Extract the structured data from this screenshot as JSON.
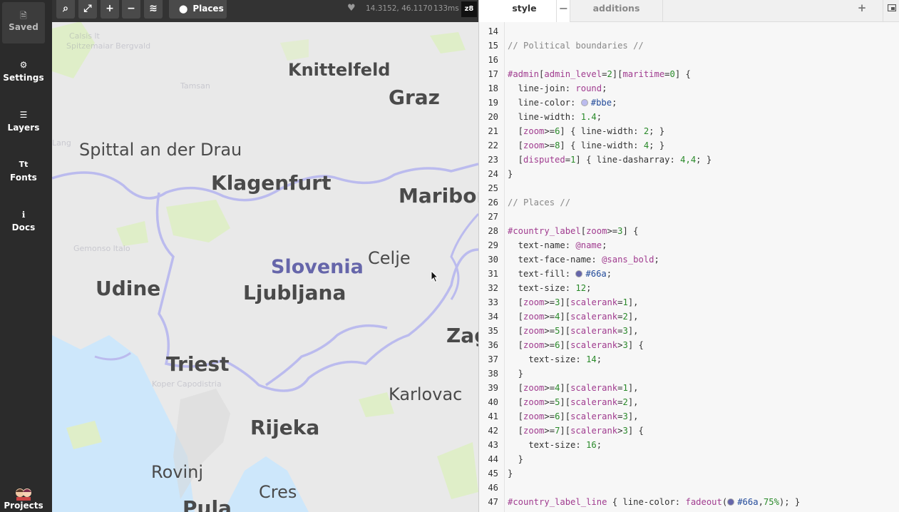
{
  "sidebar": {
    "items": [
      {
        "label": "Saved",
        "icon": "document-icon",
        "glyph": "🗎"
      },
      {
        "label": "Settings",
        "icon": "gear-icon",
        "glyph": "⚙"
      },
      {
        "label": "Layers",
        "icon": "layers-icon",
        "glyph": "☰"
      },
      {
        "label": "Fonts",
        "icon": "fonts-icon",
        "glyph": "Tt"
      },
      {
        "label": "Docs",
        "icon": "info-icon",
        "glyph": "ℹ"
      }
    ],
    "projects_label": "Projects"
  },
  "map_toolbar": {
    "buttons": [
      {
        "name": "search-button",
        "icon": "search-icon",
        "glyph": "⌕"
      },
      {
        "name": "fullscreen-button",
        "icon": "expand-icon",
        "glyph": "⤢"
      },
      {
        "name": "zoom-in-button",
        "icon": "plus-icon",
        "glyph": "+"
      },
      {
        "name": "zoom-out-button",
        "icon": "minus-icon",
        "glyph": "−"
      },
      {
        "name": "layers-query-button",
        "icon": "layers-search-icon",
        "glyph": "≋"
      }
    ],
    "places_label": "Places",
    "coordinates": "14.3152, 46.1170",
    "render_time": "133ms",
    "zoom_level": "z8"
  },
  "map": {
    "country_label": "Slovenia",
    "cities": [
      "Knittelfeld",
      "Graz",
      "Spittal an der Drau",
      "Klagenfurt",
      "Maribor",
      "Celje",
      "Udine",
      "Ljubljana",
      "Zag",
      "Triest",
      "Karlovac",
      "Rijeka",
      "Rovinj",
      "Cres",
      "Pula"
    ],
    "colors": {
      "land": "#e9e9e9",
      "water": "#cde7fb",
      "park": "#dfeec8",
      "boundary": "#bbe",
      "country_text": "#66a"
    }
  },
  "editor": {
    "tabs": [
      {
        "label": "style",
        "active": true
      },
      {
        "label": "additions",
        "active": false
      }
    ],
    "close_glyph": "−",
    "add_glyph": "+",
    "lines": [
      {
        "n": "14",
        "t": ""
      },
      {
        "n": "15",
        "t": "// Political boundaries //"
      },
      {
        "n": "16",
        "t": ""
      },
      {
        "n": "17",
        "t": "#admin[admin_level=2][maritime=0] {"
      },
      {
        "n": "18",
        "t": "  line-join: round;"
      },
      {
        "n": "19",
        "t": "  line-color: #bbe;"
      },
      {
        "n": "20",
        "t": "  line-width: 1.4;"
      },
      {
        "n": "21",
        "t": "  [zoom>=6] { line-width: 2; }"
      },
      {
        "n": "22",
        "t": "  [zoom>=8] { line-width: 4; }"
      },
      {
        "n": "23",
        "t": "  [disputed=1] { line-dasharray: 4,4; }"
      },
      {
        "n": "24",
        "t": "}"
      },
      {
        "n": "25",
        "t": ""
      },
      {
        "n": "26",
        "t": "// Places //"
      },
      {
        "n": "27",
        "t": ""
      },
      {
        "n": "28",
        "t": "#country_label[zoom>=3] {"
      },
      {
        "n": "29",
        "t": "  text-name: @name;"
      },
      {
        "n": "30",
        "t": "  text-face-name: @sans_bold;"
      },
      {
        "n": "31",
        "t": "  text-fill: #66a;"
      },
      {
        "n": "32",
        "t": "  text-size: 12;"
      },
      {
        "n": "33",
        "t": "  [zoom>=3][scalerank=1],"
      },
      {
        "n": "34",
        "t": "  [zoom>=4][scalerank=2],"
      },
      {
        "n": "35",
        "t": "  [zoom>=5][scalerank=3],"
      },
      {
        "n": "36",
        "t": "  [zoom>=6][scalerank>3] {"
      },
      {
        "n": "37",
        "t": "    text-size: 14;"
      },
      {
        "n": "38",
        "t": "  }"
      },
      {
        "n": "39",
        "t": "  [zoom>=4][scalerank=1],"
      },
      {
        "n": "40",
        "t": "  [zoom>=5][scalerank=2],"
      },
      {
        "n": "41",
        "t": "  [zoom>=6][scalerank=3],"
      },
      {
        "n": "42",
        "t": "  [zoom>=7][scalerank>3] {"
      },
      {
        "n": "43",
        "t": "    text-size: 16;"
      },
      {
        "n": "44",
        "t": "  }"
      },
      {
        "n": "45",
        "t": "}"
      },
      {
        "n": "46",
        "t": ""
      },
      {
        "n": "47",
        "t": "#country_label_line { line-color: fadeout(#66a,75%); }"
      }
    ]
  }
}
